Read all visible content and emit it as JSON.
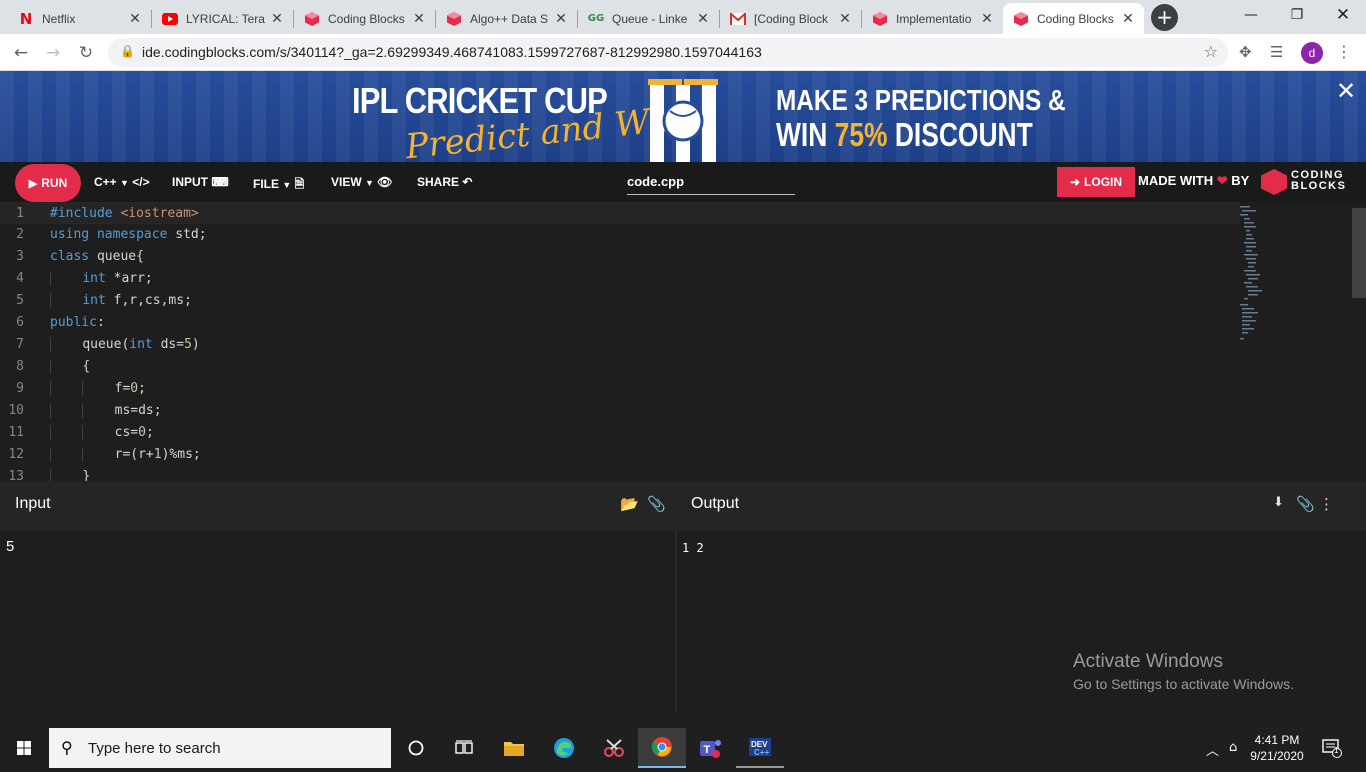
{
  "browser": {
    "tabs": [
      {
        "label": "Netflix",
        "icon": "netflix-icon",
        "color": "#e50914"
      },
      {
        "label": "LYRICAL: Tera F",
        "icon": "youtube-icon",
        "color": "#ff0000"
      },
      {
        "label": "Coding Blocks",
        "icon": "coding-blocks-icon",
        "color": "#e32b4a"
      },
      {
        "label": "Algo++ Data S",
        "icon": "coding-blocks-icon",
        "color": "#e32b4a"
      },
      {
        "label": "Queue - Linke",
        "icon": "geeksforgeeks-icon",
        "color": "#2f8d46"
      },
      {
        "label": "[Coding Block",
        "icon": "gmail-icon",
        "color": "#d93025"
      },
      {
        "label": "Implementatio",
        "icon": "coding-blocks-icon",
        "color": "#e32b4a"
      },
      {
        "label": "Coding Blocks",
        "icon": "coding-blocks-icon",
        "color": "#e32b4a",
        "active": true
      }
    ],
    "url": "ide.codingblocks.com/s/340114?_ga=2.69299349.468741083.1599727687-812992980.1597044163",
    "profile_initial": "d"
  },
  "banner": {
    "title": "IPL CRICKET CUP",
    "script": "Predict and Win",
    "promo_line1": "MAKE 3 PREDICTIONS &",
    "promo_line2_prefix": "WIN ",
    "promo_line2_highlight": "75%",
    "promo_line2_suffix": " DISCOUNT"
  },
  "toolbar": {
    "run": "RUN",
    "language": "C++",
    "input": "INPUT",
    "file": "FILE",
    "view": "VIEW",
    "share": "SHARE",
    "filename": "code.cpp",
    "login": "LOGIN",
    "made_with": "MADE WITH",
    "by": "BY",
    "brand_line1": "CODING",
    "brand_line2": "BLOCKS"
  },
  "editor": {
    "line_numbers": [
      "1",
      "2",
      "3",
      "4",
      "5",
      "6",
      "7",
      "8",
      "9",
      "10",
      "11",
      "12",
      "13"
    ]
  },
  "input_pane": {
    "title": "Input",
    "value": "5"
  },
  "output_pane": {
    "title": "Output",
    "value": "1 2"
  },
  "watermark": {
    "line1": "Activate Windows",
    "line2": "Go to Settings to activate Windows."
  },
  "taskbar": {
    "search_placeholder": "Type here to search",
    "time": "4:41 PM",
    "date": "9/21/2020",
    "notification_count": "1"
  },
  "colors": {
    "accent": "#e32b4a",
    "editor_bg": "#1e1e1e",
    "keyword": "#569cd6",
    "string": "#ce9178",
    "number": "#b5cea8"
  }
}
